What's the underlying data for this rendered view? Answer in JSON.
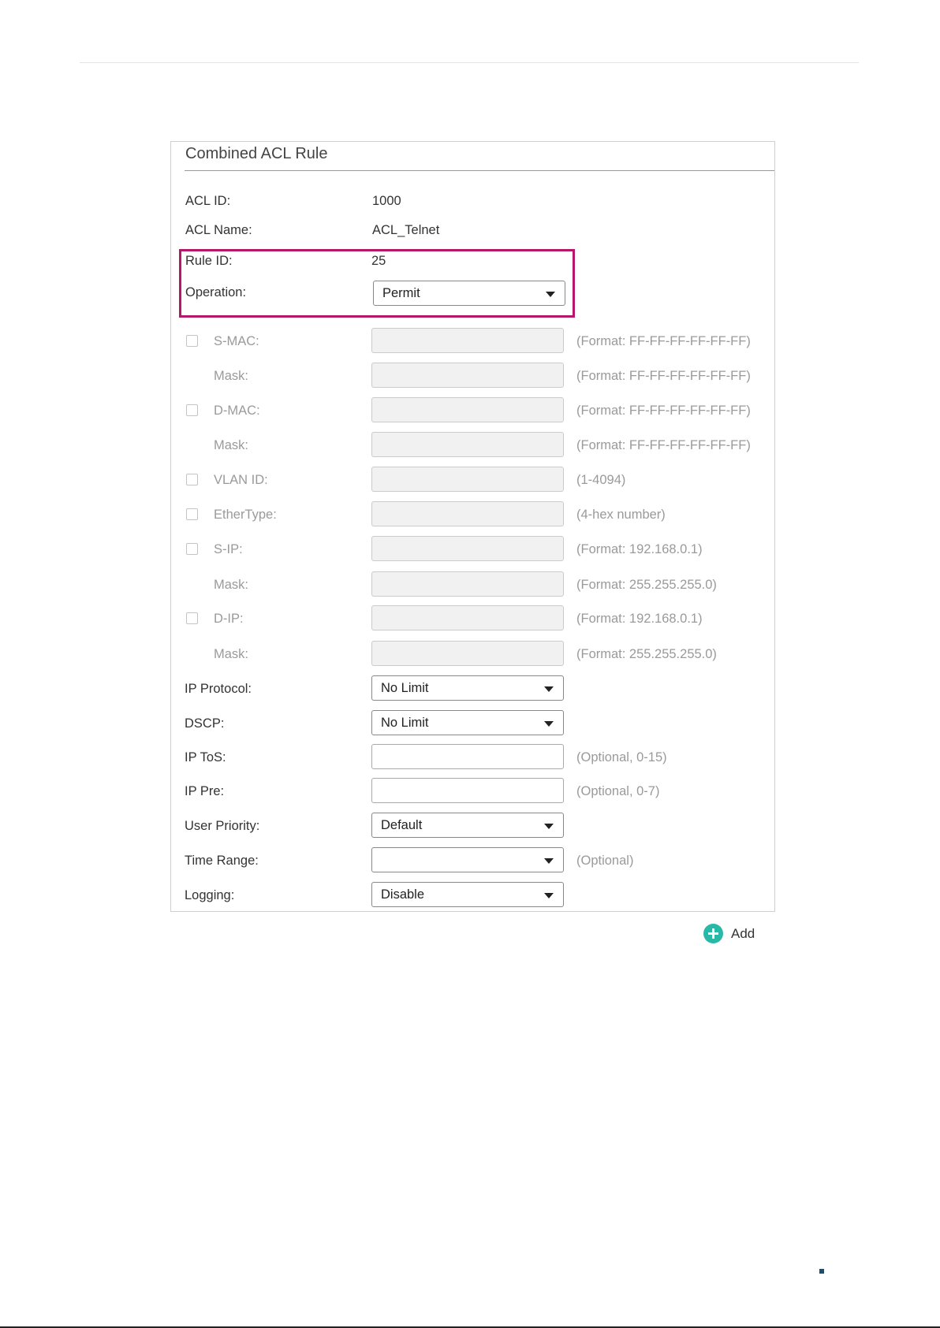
{
  "panel": {
    "title": "Combined ACL Rule"
  },
  "info": {
    "acl_id": {
      "label": "ACL ID:",
      "value": "1000"
    },
    "acl_name": {
      "label": "ACL Name:",
      "value": "ACL_Telnet"
    },
    "rule_id": {
      "label": "Rule ID:",
      "value": "25"
    },
    "operation": {
      "label": "Operation:",
      "selected": "Permit"
    }
  },
  "fields": {
    "s_mac": {
      "label": "S-MAC:",
      "hint": "(Format: FF-FF-FF-FF-FF-FF)",
      "checked": false
    },
    "s_mac_mask": {
      "label": "Mask:",
      "hint": "(Format: FF-FF-FF-FF-FF-FF)"
    },
    "d_mac": {
      "label": "D-MAC:",
      "hint": "(Format: FF-FF-FF-FF-FF-FF)",
      "checked": false
    },
    "d_mac_mask": {
      "label": "Mask:",
      "hint": "(Format: FF-FF-FF-FF-FF-FF)"
    },
    "vlan_id": {
      "label": "VLAN ID:",
      "hint": "(1-4094)",
      "checked": false
    },
    "ethertype": {
      "label": "EtherType:",
      "hint": "(4-hex number)",
      "checked": false
    },
    "s_ip": {
      "label": "S-IP:",
      "hint": "(Format: 192.168.0.1)",
      "checked": false
    },
    "s_ip_mask": {
      "label": "Mask:",
      "hint": "(Format: 255.255.255.0)"
    },
    "d_ip": {
      "label": "D-IP:",
      "hint": "(Format: 192.168.0.1)",
      "checked": false
    },
    "d_ip_mask": {
      "label": "Mask:",
      "hint": "(Format: 255.255.255.0)"
    },
    "ip_protocol": {
      "label": "IP Protocol:",
      "selected": "No Limit"
    },
    "dscp": {
      "label": "DSCP:",
      "selected": "No Limit"
    },
    "ip_tos": {
      "label": "IP ToS:",
      "hint": "(Optional, 0-15)",
      "value": ""
    },
    "ip_pre": {
      "label": "IP Pre:",
      "hint": "(Optional, 0-7)",
      "value": ""
    },
    "user_priority": {
      "label": "User Priority:",
      "selected": "Default"
    },
    "time_range": {
      "label": "Time Range:",
      "hint": "(Optional)",
      "selected": ""
    },
    "logging": {
      "label": "Logging:",
      "selected": "Disable"
    }
  },
  "actions": {
    "add_label": "Add"
  },
  "colors": {
    "highlight": "#b5176a",
    "add_icon": "#27b9a8"
  },
  "icons": {
    "add": "plus-circle-icon",
    "dropdown": "caret-down-icon"
  }
}
